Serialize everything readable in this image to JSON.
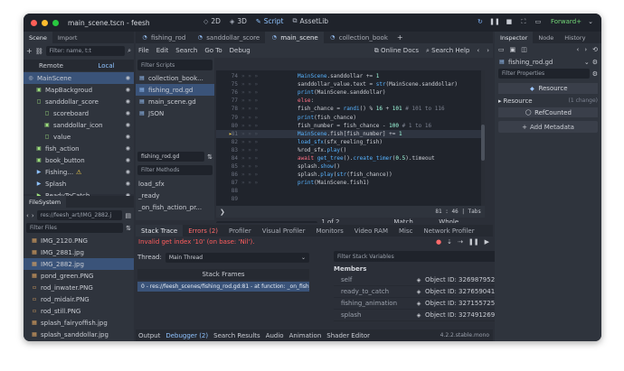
{
  "window": {
    "title": "main_scene.tscn - feesh"
  },
  "workspaces": [
    {
      "label": "2D",
      "icon": "◇"
    },
    {
      "label": "3D",
      "icon": "◈"
    },
    {
      "label": "Script",
      "icon": "✎"
    },
    {
      "label": "AssetLib",
      "icon": "⧉"
    }
  ],
  "run": {
    "forward": "Forward+"
  },
  "scene_panel": {
    "tabs": [
      "Scene",
      "Import"
    ],
    "filter_placeholder": "Filter: name, t:t",
    "modes": [
      "Remote",
      "Local"
    ],
    "nodes": [
      {
        "name": "MainScene",
        "depth": 0
      },
      {
        "name": "MapBackgroud",
        "depth": 1
      },
      {
        "name": "sanddollar_score",
        "depth": 1
      },
      {
        "name": "scoreboard",
        "depth": 2
      },
      {
        "name": "sanddollar_icon",
        "depth": 2
      },
      {
        "name": "value",
        "depth": 2
      },
      {
        "name": "fish_action",
        "depth": 1
      },
      {
        "name": "book_button",
        "depth": 1
      },
      {
        "name": "Fishing...",
        "depth": 1
      },
      {
        "name": "Splash",
        "depth": 1
      },
      {
        "name": "ReadyToCatch",
        "depth": 1
      }
    ]
  },
  "filesystem": {
    "title": "FileSystem",
    "path": "res://feesh_art/IMG_2882.j",
    "filter_placeholder": "Filter Files",
    "files": [
      "IMG_2120.PNG",
      "IMG_2881.jpg",
      "IMG_2882.jpg",
      "pond_green.PNG",
      "rod_inwater.PNG",
      "rod_midair.PNG",
      "rod_still.PNG",
      "splash_fairyoffish.jpg",
      "splash_sanddollar.jpg"
    ],
    "selected_index": 2
  },
  "script_tabs": [
    "fishing_rod",
    "sanddollar_score",
    "main_scene",
    "collection_book"
  ],
  "active_script_tab": 2,
  "script_menu": [
    "File",
    "Edit",
    "Search",
    "Go To",
    "Debug"
  ],
  "script_toolbar": {
    "online_docs": "Online Docs",
    "search_help": "Search Help"
  },
  "script_list": {
    "filter_placeholder": "Filter Scripts",
    "items": [
      "collection_book...",
      "fishing_rod.gd",
      "main_scene.gd",
      "JSON"
    ],
    "selected_index": 1,
    "current": "fishing_rod.gd",
    "methods_placeholder": "Filter Methods",
    "methods": [
      "load_sfx",
      "_ready",
      "_on_fish_action_pr..."
    ]
  },
  "code": {
    "lines": [
      {
        "n": "74",
        "i": "",
        "h": "<span class=\"fn\">MainScene</span>.sanddollar += <span class=\"nm\">1</span>"
      },
      {
        "n": "75",
        "i": "",
        "h": "sanddollar_value.text = <span class=\"fn\">str</span>(MainScene.sanddollar)"
      },
      {
        "n": "76",
        "i": "",
        "h": "<span class=\"fn\">print</span>(MainScene.sanddollar)"
      },
      {
        "n": "77",
        "i": "",
        "h": "<span class=\"kw\">else</span>:"
      },
      {
        "n": "78",
        "i": "",
        "h": "fish_chance = <span class=\"fn\">randi</span>() % <span class=\"nm\">16</span> + <span class=\"nm\">101</span> <span class=\"cm\"># 101 to 116</span>"
      },
      {
        "n": "79",
        "i": "",
        "h": "<span class=\"fn\">print</span>(fish_chance)"
      },
      {
        "n": "80",
        "i": "",
        "h": "fish_number = fish_chance - <span class=\"nm\">100</span> <span class=\"cm\"># 1 to 16</span>"
      },
      {
        "n": "81",
        "i": "",
        "h": "<span class=\"fn\">MainScene</span>.fish[fish_number] += <span class=\"nm\">1</span>"
      },
      {
        "n": "82",
        "i": "",
        "h": "<span class=\"fn\">load_sfx</span>(sfx_reeling_fish)"
      },
      {
        "n": "83",
        "i": "",
        "h": "%rod_sfx.<span class=\"fn\">play</span>()"
      },
      {
        "n": "84",
        "i": "",
        "h": "<span class=\"kw\">await</span> <span class=\"fn\">get_tree</span>().<span class=\"fn\">create_timer</span>(<span class=\"nm\">0.5</span>).timeout"
      },
      {
        "n": "85",
        "i": "",
        "h": "splash.<span class=\"fn\">show</span>()"
      },
      {
        "n": "86",
        "i": "",
        "h": "splash.<span class=\"fn\">play</span>(<span class=\"fn\">str</span>(fish_chance))"
      },
      {
        "n": "87",
        "i": "",
        "h": "<span class=\"fn\">print</span>(MainScene.fish1)"
      },
      {
        "n": "88",
        "i": "",
        "h": ""
      },
      {
        "n": "89",
        "i": "",
        "h": ""
      }
    ],
    "current_line_index": 7,
    "caret": "81 :   46  |  Tabs"
  },
  "find": {
    "query": "fish1",
    "matches": "1 of 2 matches",
    "match_case": "Match Case",
    "whole_words": "Whole Words"
  },
  "debugger": {
    "tabs": [
      "Stack Trace",
      "Errors (2)",
      "Profiler",
      "Visual Profiler",
      "Monitors",
      "Video RAM",
      "Misc",
      "Network Profiler"
    ],
    "error": "Invalid get index '10' (on base: 'Nil').",
    "thread_label": "Thread:",
    "thread_value": "Main Thread",
    "stack_header": "Stack Frames",
    "frame": "0 - res://feesh_scenes/fishing_rod.gd:81 - at function: _on_fish_a...",
    "filter_vars_placeholder": "Filter Stack Variables",
    "members_label": "Members",
    "members": [
      {
        "name": "self",
        "value": "Object ID: 32698795295"
      },
      {
        "name": "ready_to_catch",
        "value": "Object ID: 32765904163"
      },
      {
        "name": "fishing_animation",
        "value": "Object ID: 32715572512"
      },
      {
        "name": "splash",
        "value": "Object ID: 32749126946"
      }
    ]
  },
  "bottom_tabs": [
    "Output",
    "Debugger (2)",
    "Search Results",
    "Audio",
    "Animation",
    "Shader Editor"
  ],
  "version": "4.2.2.stable.mono",
  "inspector": {
    "tabs": [
      "Inspector",
      "Node",
      "History"
    ],
    "object": "fishing_rod.gd",
    "filter_placeholder": "Filter Properties",
    "resource_title": "Resource",
    "resource_label": "Resource",
    "resource_change": "(1 change)",
    "refcounted": "RefCounted",
    "add_metadata": "Add Metadata"
  },
  "colors": {
    "accent": "#57b3ff",
    "warning": "#ffd84d",
    "error": "#ff5d5d"
  }
}
